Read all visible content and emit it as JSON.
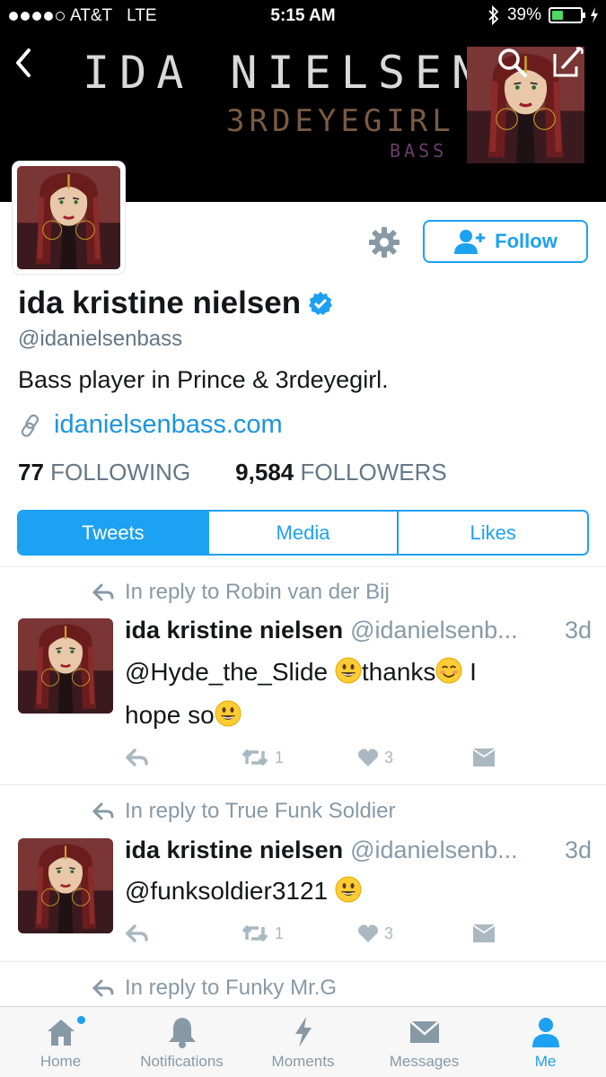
{
  "status_bar": {
    "carrier": "AT&T",
    "network": "LTE",
    "time": "5:15 AM",
    "battery": "39%",
    "battery_level": 0.39
  },
  "banner": {
    "title": "IDA NIELSEN",
    "subtitle": "3RDEYEGIRL",
    "subtitle2": "BASS"
  },
  "profile": {
    "name": "ida kristine nielsen",
    "handle": "@idanielsenbass",
    "bio": "Bass player in Prince & 3rdeyegirl.",
    "link": "idanielsenbass.com",
    "following_count": "77",
    "following_label": "FOLLOWING",
    "followers_count": "9,584",
    "followers_label": "FOLLOWERS",
    "follow_label": "Follow",
    "verified": true
  },
  "tabs": [
    {
      "label": "Tweets",
      "active": true
    },
    {
      "label": "Media",
      "active": false
    },
    {
      "label": "Likes",
      "active": false
    }
  ],
  "tweets": [
    {
      "reply_to": "In reply to Robin van der Bij",
      "name": "ida kristine nielsen",
      "handle": "@idanielsenb...",
      "time": "3d",
      "text_1": "@Hyde_the_Slide ",
      "text_2": "thanks",
      "text_3": " I",
      "text_4": "hope so",
      "retweets": "1",
      "likes": "3"
    },
    {
      "reply_to": "In reply to True Funk Soldier",
      "name": "ida kristine nielsen",
      "handle": "@idanielsenb...",
      "time": "3d",
      "text_1": "@funksoldier3121 ",
      "retweets": "1",
      "likes": "3"
    },
    {
      "reply_to": "In reply to Funky Mr.G"
    }
  ],
  "tabbar": [
    {
      "label": "Home",
      "icon": "home-icon"
    },
    {
      "label": "Notifications",
      "icon": "bell-icon"
    },
    {
      "label": "Moments",
      "icon": "lightning-icon"
    },
    {
      "label": "Messages",
      "icon": "envelope-icon"
    },
    {
      "label": "Me",
      "icon": "person-icon",
      "active": true
    }
  ],
  "colors": {
    "accent": "#1da1f2",
    "link": "#1b95e0",
    "muted": "#657786"
  }
}
